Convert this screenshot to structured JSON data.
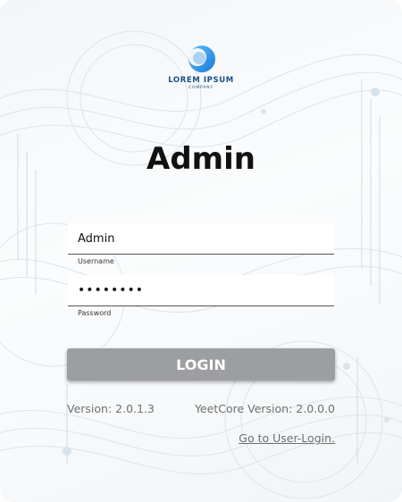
{
  "logo": {
    "name": "LOREM IPSUM",
    "subtitle": "COMPANY",
    "icon": "crescent-logo-icon",
    "color": "#2f95e6"
  },
  "title": "Admin",
  "form": {
    "username": {
      "value": "Admin",
      "label": "Username"
    },
    "password": {
      "value": "••••••••",
      "label": "Password"
    }
  },
  "login_button": {
    "label": "LOGIN",
    "color": "#9d9ea1"
  },
  "footer": {
    "version": "Version: 2.0.1.3",
    "core_version": "YeetCore Version: 2.0.0.0",
    "user_login_link": "Go to User-Login."
  }
}
